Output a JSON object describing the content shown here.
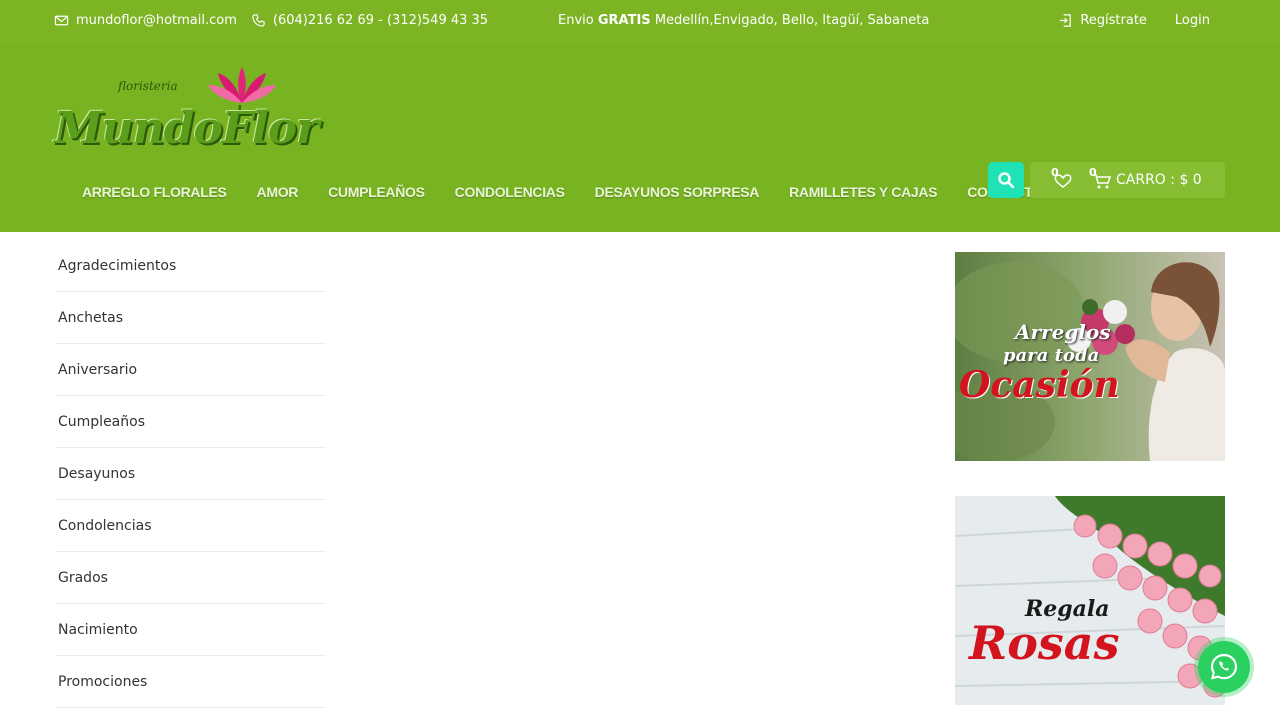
{
  "topbar": {
    "email": "mundoflor@hotmail.com",
    "phones": "(604)216 62 69 - (312)549 43 35",
    "shipping_prefix": "Envio",
    "shipping_bold": "GRATIS",
    "shipping_suffix": "Medellín,Envigado, Bello, Itagüí, Sabaneta",
    "register": "Regístrate",
    "login": "Login"
  },
  "brand": {
    "small": "floristeria",
    "name": "MundoFlor"
  },
  "nav": [
    "ARREGLO FLORALES",
    "AMOR",
    "CUMPLEAÑOS",
    "CONDOLENCIAS",
    "DESAYUNOS SORPRESA",
    "RAMILLETES Y CAJAS",
    "CONTACTO"
  ],
  "header": {
    "wishlist_count": "0",
    "cart_count": "0",
    "cart_label": "CARRO : $ 0"
  },
  "categories": [
    "Agradecimientos",
    "Anchetas",
    "Aniversario",
    "Cumpleaños",
    "Desayunos",
    "Condolencias",
    "Grados",
    "Nacimiento",
    "Promociones"
  ],
  "banners": {
    "b1_line1": "Arreglos",
    "b1_line2": "para toda",
    "b1_line3": "Ocasión",
    "b2_line1": "Regala",
    "b2_line2": "Rosas"
  },
  "colors": {
    "topbar": "#7cb424",
    "header": "#78b322",
    "search": "#1fe3b4",
    "whatsapp": "#2bd160"
  }
}
